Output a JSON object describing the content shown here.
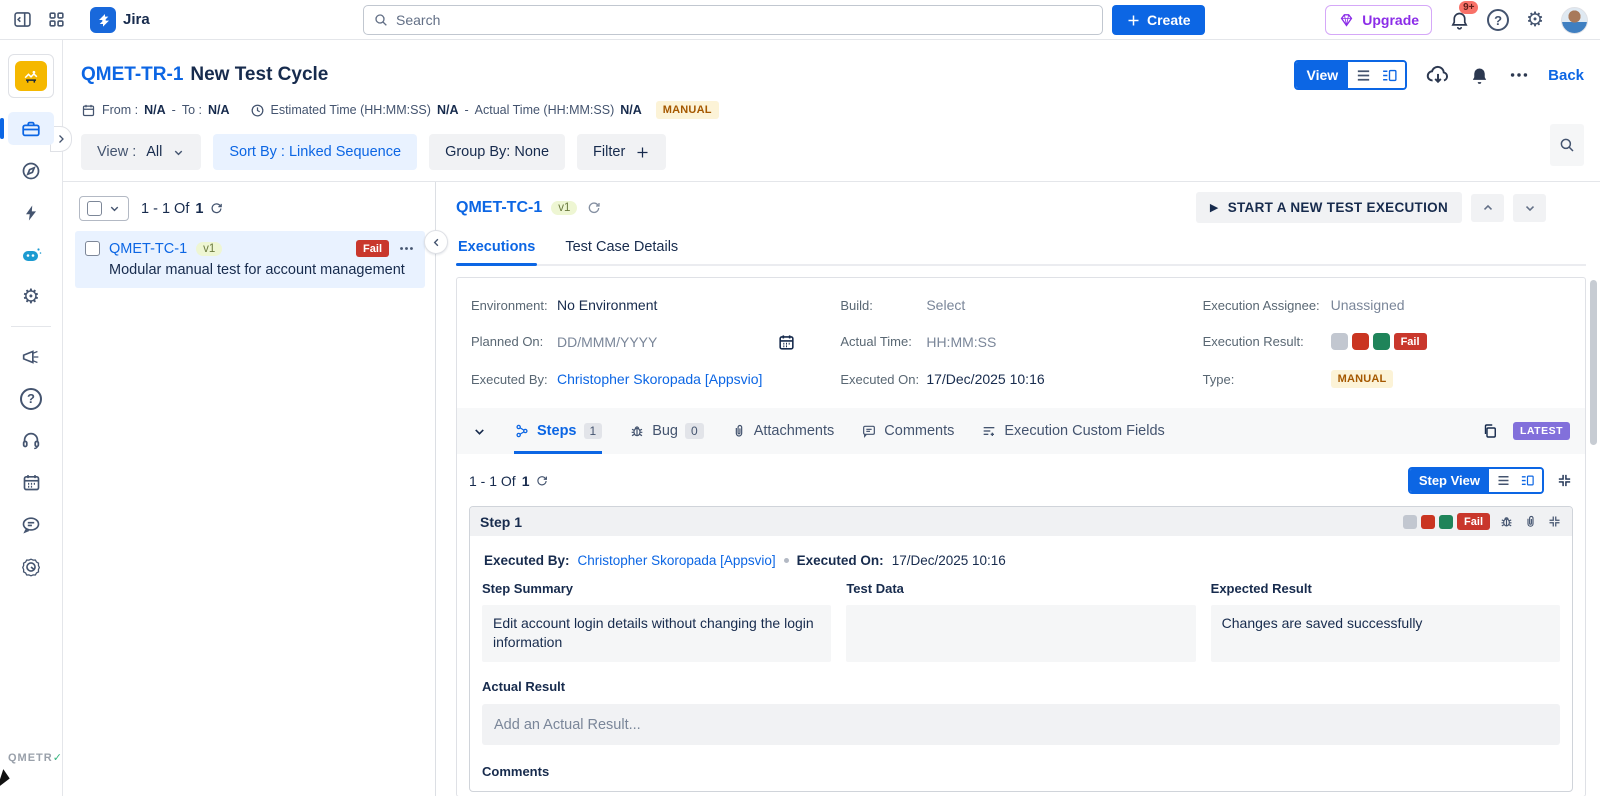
{
  "colors": {
    "accent": "#0c66e4",
    "fail_red": "#c9372c",
    "pass_green": "#1f845a",
    "na_gray": "#c2c7d0",
    "latest_purple": "#8270db",
    "manual_bg": "#fcf3d7",
    "manual_text": "#a55800"
  },
  "topbar": {
    "app_name": "Jira",
    "search_placeholder": "Search",
    "create_label": "Create",
    "upgrade_label": "Upgrade",
    "notification_badge": "9+",
    "icons": [
      "sidebar-toggle-icon",
      "app-switcher-icon",
      "jira-logo",
      "search-icon",
      "plus-icon",
      "gem-icon",
      "bell-icon",
      "help-icon",
      "gear-icon",
      "avatar"
    ]
  },
  "sidebar": {
    "brand": "QMETR",
    "brand_tick": "✓",
    "icons": [
      "qmetry-app-logo",
      "briefcase-icon",
      "compass-icon",
      "bolt-icon",
      "ai-robot-icon",
      "gear-icon",
      "megaphone-icon",
      "question-icon",
      "headset-icon",
      "calendar-icon",
      "chat-icon",
      "target-icon"
    ]
  },
  "header": {
    "key": "QMET-TR-1",
    "title": "New Test Cycle",
    "from_label": "From :",
    "from_value": "N/A",
    "dash": "-",
    "to_label": "To :",
    "to_value": "N/A",
    "estimated_label": "Estimated Time (HH:MM:SS)",
    "estimated_value": "N/A",
    "actual_label": "Actual Time (HH:MM:SS)",
    "actual_value": "N/A",
    "type_badge": "MANUAL",
    "view_toggle_label": "View",
    "back_label": "Back"
  },
  "toolbar": {
    "view_label": "View :",
    "view_value": "All",
    "sort_by": "Sort By : Linked Sequence",
    "group_by": "Group By: None",
    "filter_label": "Filter"
  },
  "list": {
    "pagination_prefix": "1 - 1 Of",
    "pagination_total": "1",
    "row": {
      "key": "QMET-TC-1",
      "version": "v1",
      "status": "Fail",
      "summary": "Modular manual test for account management"
    }
  },
  "detail": {
    "key": "QMET-TC-1",
    "version": "v1",
    "start_button": "START A NEW TEST EXECUTION",
    "tabs": {
      "executions": "Executions",
      "details": "Test Case Details"
    },
    "fields": {
      "environment_label": "Environment:",
      "environment_value": "No Environment",
      "build_label": "Build:",
      "build_value": "Select",
      "assignee_label": "Execution Assignee:",
      "assignee_value": "Unassigned",
      "planned_label": "Planned On:",
      "planned_value": "DD/MMM/YYYY",
      "actual_time_label": "Actual Time:",
      "actual_time_value": "HH:MM:SS",
      "result_label": "Execution Result:",
      "result_value": "Fail",
      "executed_by_label": "Executed By:",
      "executed_by_value": "Christopher Skoropada [Appsvio]",
      "executed_on_label": "Executed On:",
      "executed_on_value": "17/Dec/2025 10:16",
      "type_label": "Type:",
      "type_value": "MANUAL"
    },
    "exec_tabs": {
      "steps_label": "Steps",
      "steps_count": "1",
      "bug_label": "Bug",
      "bug_count": "0",
      "attachments_label": "Attachments",
      "comments_label": "Comments",
      "custom_fields_label": "Execution Custom Fields",
      "latest_badge": "LATEST"
    },
    "steps_section": {
      "pagination_prefix": "1 - 1 Of",
      "pagination_total": "1",
      "step_view_label": "Step View"
    },
    "step": {
      "title": "Step 1",
      "status": "Fail",
      "executed_by_label": "Executed By:",
      "executed_by_value": "Christopher Skoropada [Appsvio]",
      "executed_on_label": "Executed On:",
      "executed_on_value": "17/Dec/2025 10:16",
      "col_step_summary": "Step Summary",
      "col_test_data": "Test Data",
      "col_expected": "Expected Result",
      "step_summary_text": "Edit account login details without changing the login information",
      "test_data_text": "",
      "expected_text": "Changes are saved successfully",
      "actual_result_label": "Actual Result",
      "actual_result_placeholder": "Add an Actual Result...",
      "comments_label": "Comments"
    }
  }
}
